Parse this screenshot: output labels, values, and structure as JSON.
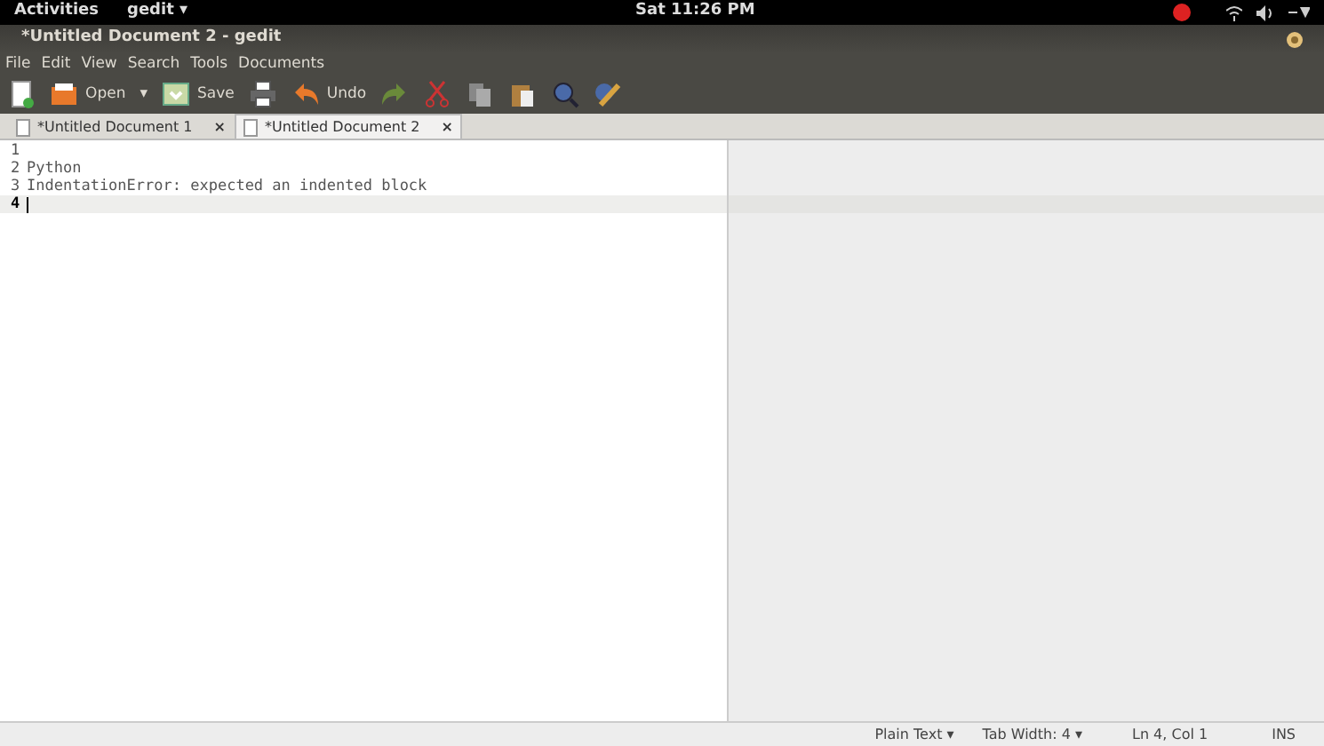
{
  "top_bar": {
    "activities": "Activities",
    "app_menu": "gedit ▾",
    "clock": "Sat 11:26 PM"
  },
  "window": {
    "title": "*Untitled Document 2 - gedit"
  },
  "menu": [
    "File",
    "Edit",
    "View",
    "Search",
    "Tools",
    "Documents"
  ],
  "toolbar": [
    {
      "kind": "new"
    },
    {
      "kind": "open",
      "label": "Open"
    },
    {
      "kind": "dropdown",
      "label": "▾"
    },
    {
      "kind": "save",
      "label": "Save"
    },
    {
      "kind": "print"
    },
    {
      "kind": "undo",
      "label": "Undo"
    },
    {
      "kind": "redo"
    },
    {
      "kind": "cut"
    },
    {
      "kind": "copy"
    },
    {
      "kind": "paste"
    },
    {
      "kind": "find"
    },
    {
      "kind": "replace"
    }
  ],
  "tabs": [
    {
      "label": "*Untitled Document 1",
      "close": "×",
      "selected": false
    },
    {
      "label": "*Untitled Document 2",
      "close": "×",
      "selected": true
    }
  ],
  "lines": [
    {
      "number": "1",
      "current": false
    },
    {
      "number": "2",
      "text": "Python",
      "current": false
    },
    {
      "number": "3",
      "text": "IndentationError: expected an indented block",
      "current": false
    },
    {
      "number": "4",
      "current": true
    }
  ],
  "status_bar": {
    "language": "Plain Text ▾",
    "tab_width": "Tab Width: 4 ▾",
    "position": "Ln 4, Col 1",
    "mode": "INS"
  }
}
